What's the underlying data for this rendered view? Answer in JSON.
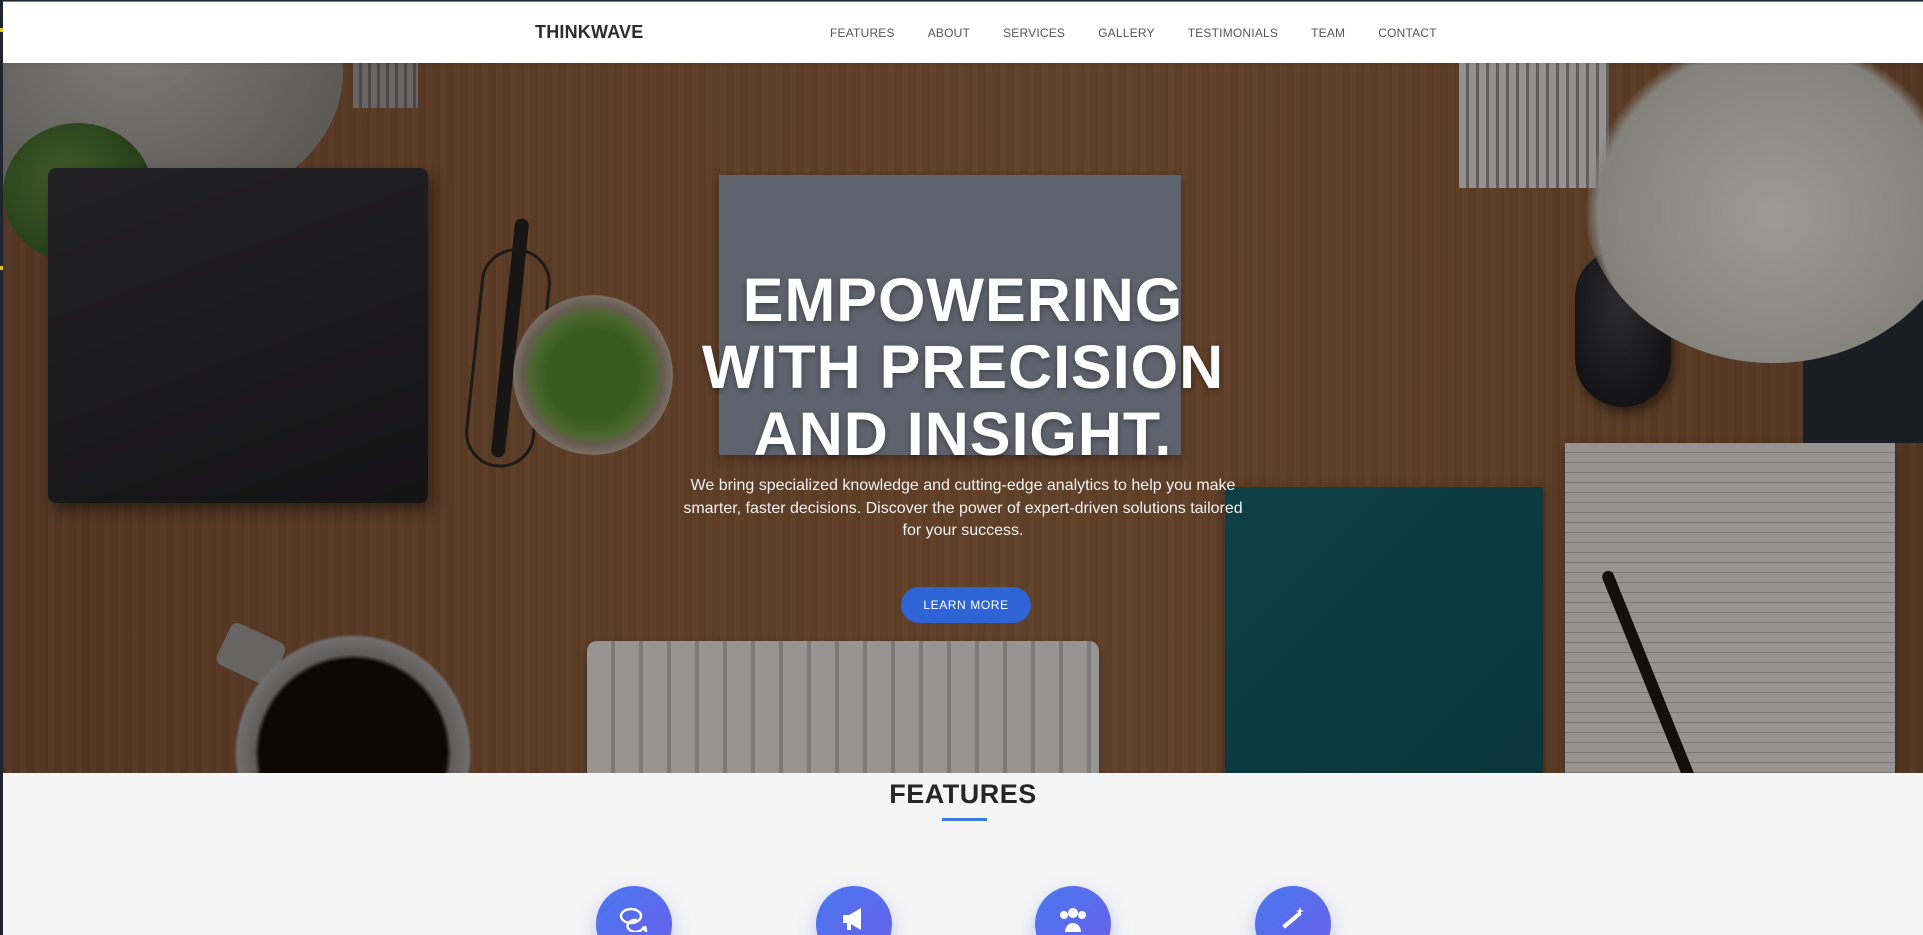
{
  "navbar": {
    "brand": "THINKWAVE",
    "links": [
      "FEATURES",
      "ABOUT",
      "SERVICES",
      "GALLERY",
      "TESTIMONIALS",
      "TEAM",
      "CONTACT"
    ]
  },
  "hero": {
    "title_lines": [
      "EMPOWERING",
      "WITH PRECISION",
      "AND INSIGHT."
    ],
    "subtitle": "We bring specialized knowledge and cutting-edge analytics to help you make smarter, faster decisions. Discover the power of expert-driven solutions tailored for your success.",
    "cta_label": "LEARN MORE"
  },
  "features": {
    "title": "FEATURES",
    "icons": [
      "chat-bubbles-icon",
      "megaphone-icon",
      "users-icon",
      "magic-wand-icon"
    ]
  },
  "colors": {
    "accent": "#2f64d6",
    "underline": "#3d7be0",
    "icon_gradient_start": "#4a78f0",
    "icon_gradient_end": "#6a5ee8"
  }
}
